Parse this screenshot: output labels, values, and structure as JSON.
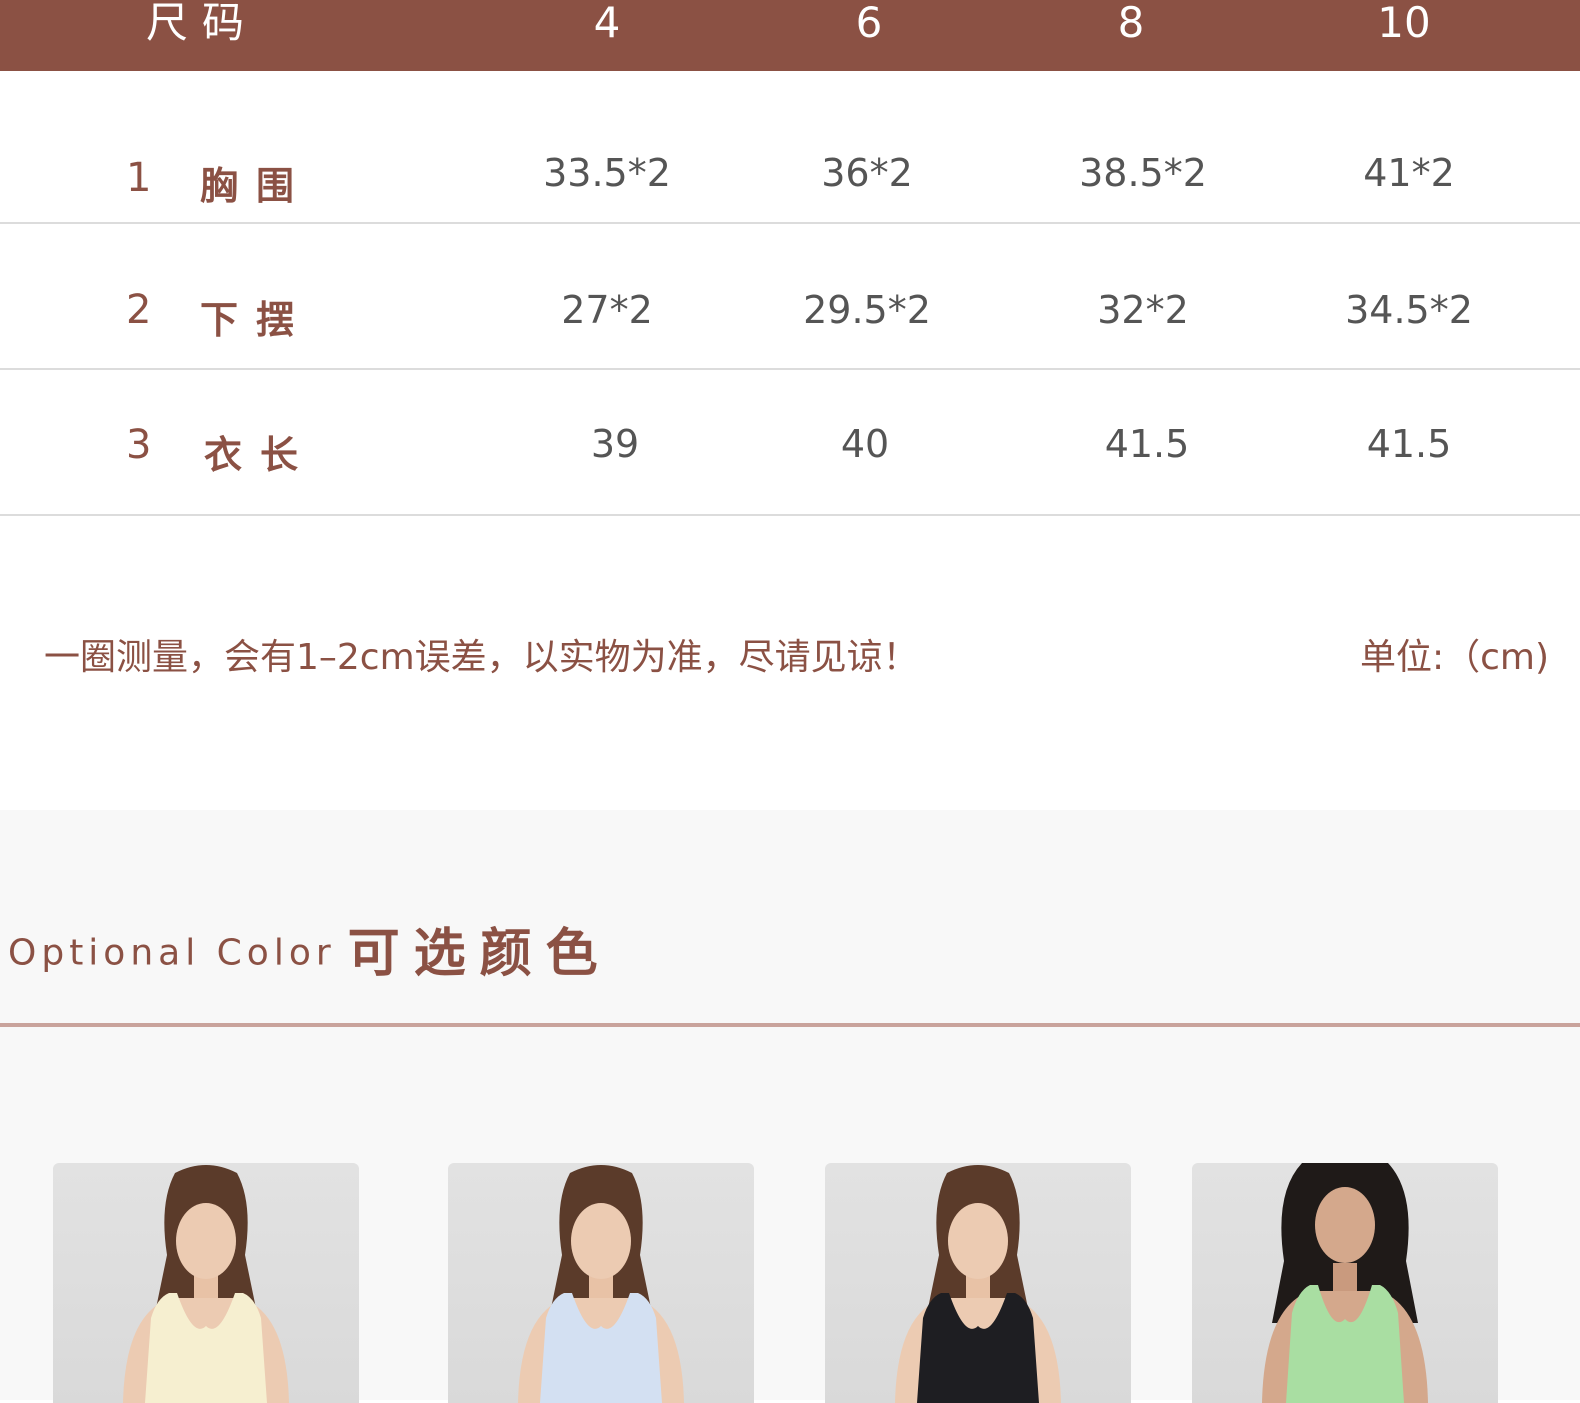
{
  "size_table": {
    "header_label": "尺码",
    "sizes": [
      "4",
      "6",
      "8",
      "10"
    ],
    "rows": [
      {
        "num": "1",
        "label": "胸围",
        "values": [
          "33.5*2",
          "36*2",
          "38.5*2",
          "41*2"
        ]
      },
      {
        "num": "2",
        "label": "下摆",
        "values": [
          "27*2",
          "29.5*2",
          "32*2",
          "34.5*2"
        ]
      },
      {
        "num": "3",
        "label": "衣长",
        "values": [
          "39",
          "40",
          "41.5",
          "41.5"
        ]
      }
    ]
  },
  "notes": {
    "disclaimer": "一圈测量，会有1–2cm误差，以实物为准，尽请见谅！",
    "unit": "单位:（cm)"
  },
  "color_section": {
    "title_en": "Optional Color",
    "title_zh": "可选颜色",
    "swatches": [
      {
        "color": "#f6efd0",
        "icon": "tank-top-cream"
      },
      {
        "color": "#d3e0f2",
        "icon": "tank-top-light-blue"
      },
      {
        "color": "#1e1e22",
        "icon": "tank-top-black"
      },
      {
        "color": "#a9dea2",
        "icon": "tank-top-mint-green"
      }
    ]
  },
  "colors": {
    "brand": "#8b5144",
    "value_text": "#555555",
    "divider": "#dcdcdc",
    "section_bg": "#f8f8f8"
  }
}
